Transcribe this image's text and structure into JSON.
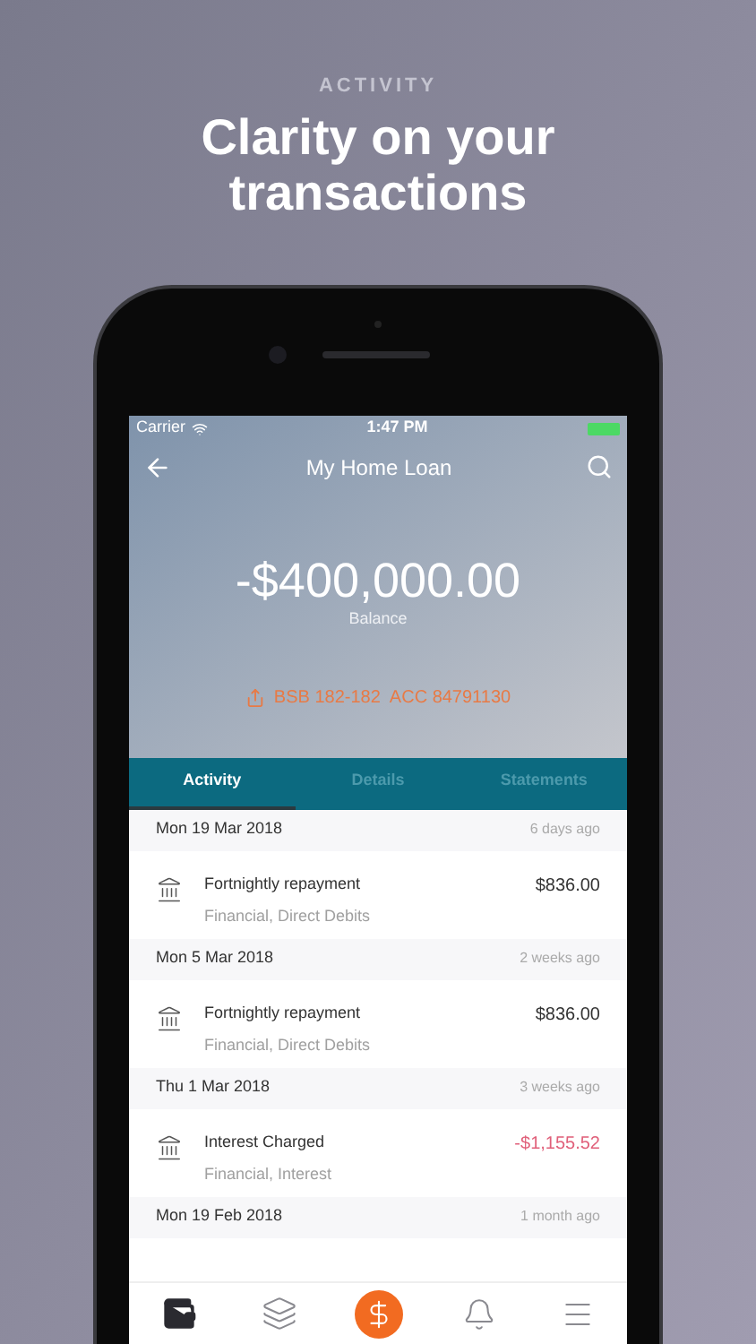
{
  "headline": {
    "eyebrow": "ACTIVITY",
    "title": "Clarity on your transactions"
  },
  "status_bar": {
    "carrier": "Carrier",
    "time": "1:47 PM"
  },
  "nav": {
    "title": "My Home Loan"
  },
  "balance": {
    "amount": "-$400,000.00",
    "label": "Balance"
  },
  "account": {
    "bsb": "BSB 182-182",
    "acc": "ACC 84791130"
  },
  "tabs": [
    {
      "label": "Activity",
      "selected": true
    },
    {
      "label": "Details",
      "selected": false
    },
    {
      "label": "Statements",
      "selected": false
    }
  ],
  "groups": [
    {
      "date": "Mon 19 Mar 2018",
      "ago": "6 days ago",
      "transactions": [
        {
          "title": "Fortnightly repayment",
          "category": "Financial, Direct Debits",
          "amount": "$836.00",
          "kind": "credit"
        }
      ]
    },
    {
      "date": "Mon 5 Mar 2018",
      "ago": "2 weeks ago",
      "transactions": [
        {
          "title": "Fortnightly repayment",
          "category": "Financial, Direct Debits",
          "amount": "$836.00",
          "kind": "credit"
        }
      ]
    },
    {
      "date": "Thu 1 Mar 2018",
      "ago": "3 weeks ago",
      "transactions": [
        {
          "title": "Interest Charged",
          "category": "Financial, Interest",
          "amount": "-$1,155.52",
          "kind": "debit"
        }
      ]
    },
    {
      "date": "Mon 19 Feb 2018",
      "ago": "1 month ago"
    }
  ],
  "bottom_nav": [
    {
      "kind": "wallet",
      "selected": true
    },
    {
      "kind": "cards",
      "selected": false
    },
    {
      "kind": "pay",
      "selected": false
    },
    {
      "kind": "bell",
      "selected": false
    },
    {
      "kind": "menu",
      "selected": false
    }
  ]
}
